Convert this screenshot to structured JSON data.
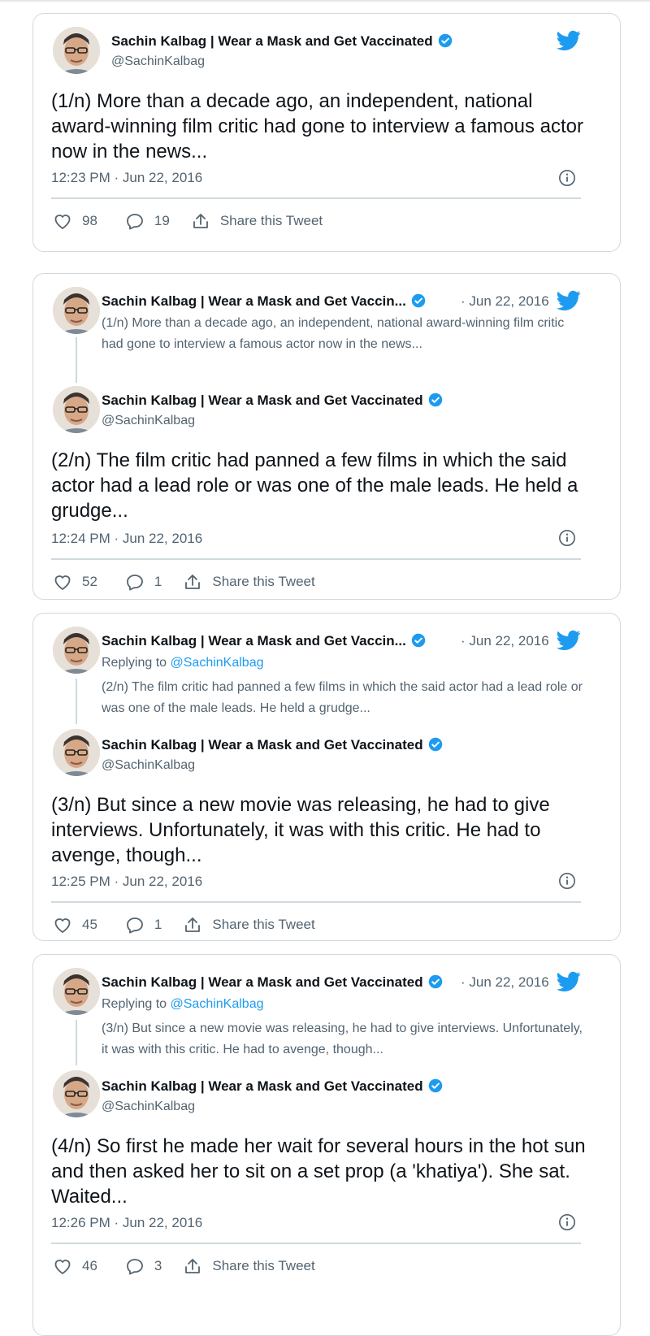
{
  "author": {
    "name": "Sachin Kalbag | Wear a Mask and Get Vaccinated",
    "name_truncated": "Sachin Kalbag | Wear a Mask and Get Vaccin...",
    "handle": "@SachinKalbag"
  },
  "icons": {
    "verified": "verified-badge-icon",
    "bird": "twitter-bird-icon",
    "info": "info-icon",
    "like": "heart-icon",
    "reply": "reply-bubble-icon",
    "share": "share-icon"
  },
  "colors": {
    "accent": "#1d9bf0",
    "muted": "#536471",
    "border": "#cfd9de"
  },
  "tweets": [
    {
      "text": "(1/n) More than a decade ago, an independent, national award-winning film critic had gone to interview a famous actor now in the news...",
      "time": "12:23 PM · Jun 22, 2016",
      "likes": "98",
      "replies": "19",
      "share_label": "Share this Tweet"
    },
    {
      "parent_date": "· Jun 22, 2016",
      "parent_text": "(1/n) More than a decade ago, an independent, national award-winning film critic had gone to interview a famous actor now in the news...",
      "text": "(2/n) The film critic had panned a few films in which the said actor had a lead role or was one of the male leads. He held a grudge...",
      "time": "12:24 PM · Jun 22, 2016",
      "likes": "52",
      "replies": "1",
      "share_label": "Share this Tweet"
    },
    {
      "parent_date": "· Jun 22, 2016",
      "replying_prefix": "Replying to ",
      "replying_to": "@SachinKalbag",
      "parent_text": "(2/n) The film critic had panned a few films in which the said actor had a lead role or was one of the male leads. He held a grudge...",
      "text": "(3/n) But since a new movie was releasing, he had to give interviews. Unfortunately, it was with this critic. He had to avenge, though...",
      "time": "12:25 PM · Jun 22, 2016",
      "likes": "45",
      "replies": "1",
      "share_label": "Share this Tweet"
    },
    {
      "parent_date": "· Jun 22, 2016",
      "replying_prefix": "Replying to ",
      "replying_to": "@SachinKalbag",
      "parent_text": "(3/n) But since a new movie was releasing, he had to give interviews. Unfortunately, it was with this critic. He had to avenge, though...",
      "text": "(4/n) So first he made her wait for several hours in the hot sun and then asked her to sit on a set prop (a 'khatiya'). She sat. Waited...",
      "time": "12:26 PM · Jun 22, 2016",
      "likes": "46",
      "replies": "3",
      "share_label": "Share this Tweet"
    }
  ]
}
